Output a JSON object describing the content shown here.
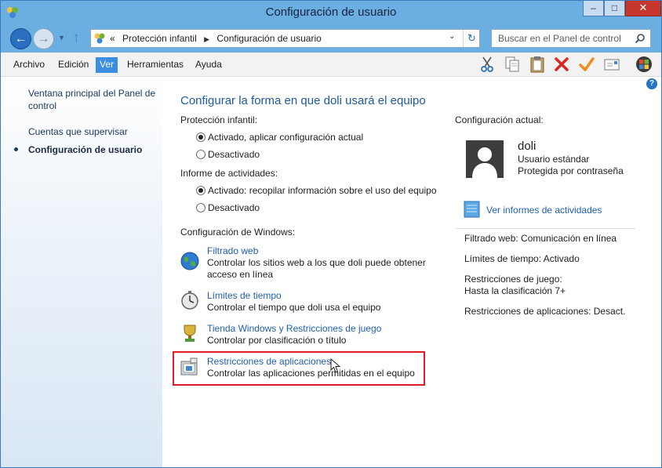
{
  "window": {
    "title": "Configuración de usuario",
    "controls": {
      "minimize": "–",
      "maximize": "□",
      "close": "✕"
    }
  },
  "address": {
    "prefix": "«",
    "crumbs": [
      "Protección infantil",
      "Configuración de usuario"
    ],
    "search_placeholder": "Buscar en el Panel de control"
  },
  "menu": {
    "items": [
      "Archivo",
      "Edición",
      "Ver",
      "Herramientas",
      "Ayuda"
    ],
    "active": "Ver"
  },
  "toolbar_icons": [
    "scissors-icon",
    "copy-icon",
    "paste-icon",
    "delete-icon",
    "checkmark-icon",
    "mail-icon",
    "windows-logo-icon"
  ],
  "sidebar": {
    "links": [
      {
        "label": "Ventana principal del Panel de control"
      },
      {
        "label": "Cuentas que supervisar"
      },
      {
        "label": "Configuración de usuario",
        "current": true
      }
    ]
  },
  "main": {
    "title": "Configurar la forma en que doli usará el equipo",
    "parental_control": {
      "label": "Protección infantil:",
      "options": [
        "Activado, aplicar configuración actual",
        "Desactivado"
      ],
      "selected": 0
    },
    "activity_report": {
      "label": "Informe de actividades:",
      "options": [
        "Activado: recopilar información sobre el uso del equipo",
        "Desactivado"
      ],
      "selected": 0
    },
    "windows_settings": {
      "label": "Configuración de Windows:",
      "items": [
        {
          "icon": "globe-icon",
          "title": "Filtrado web",
          "desc": "Controlar los sitios web a los que doli puede obtener acceso en línea"
        },
        {
          "icon": "stopwatch-icon",
          "title": "Límites de tiempo",
          "desc": "Controlar el tiempo que doli usa el equipo"
        },
        {
          "icon": "trophy-icon",
          "title": "Tienda Windows y Restricciones de juego",
          "desc": "Controlar por clasificación o título"
        },
        {
          "icon": "app-restrictions-icon",
          "title": "Restricciones de aplicaciones",
          "desc": "Controlar las aplicaciones permitidas en el equipo"
        }
      ]
    }
  },
  "current_settings": {
    "label": "Configuración actual:",
    "user": {
      "name": "doli",
      "account_type": "Usuario estándar",
      "password": "Protegida por contraseña"
    },
    "report_link": "Ver informes de actividades",
    "summary": {
      "web_filter": "Filtrado web: Comunicación en línea",
      "time_limits": "Límites de tiempo: Activado",
      "game_restrictions_label": "Restricciones de juego:",
      "game_restrictions_value": "Hasta la clasificación 7+",
      "app_restrictions": "Restricciones de aplicaciones: Desact."
    }
  },
  "colors": {
    "frame": "#6aaee2",
    "link": "#1f5fae",
    "title": "#1d5a9f",
    "highlight": "#e01b22",
    "close_button": "#c7362c"
  }
}
